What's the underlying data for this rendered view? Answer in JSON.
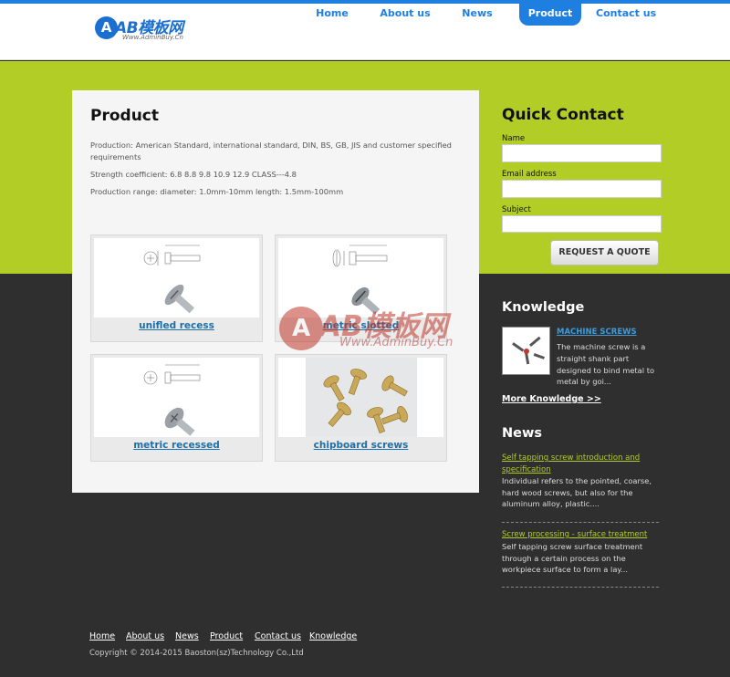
{
  "brand": {
    "logo_letter": "A",
    "logo_text": "AB模板网",
    "logo_sub": "Www.AdminBuy.Cn"
  },
  "nav": {
    "items": [
      {
        "label": "Home"
      },
      {
        "label": "About us"
      },
      {
        "label": "News"
      },
      {
        "label": "Product",
        "active": true
      },
      {
        "label": "Contact us"
      }
    ]
  },
  "product": {
    "title": "Product",
    "paragraphs": [
      "Production: American Standard, international standard, DIN, BS, GB, JIS and customer specified requirements",
      "Strength coefficient: 6.8 8.8 9.8 10.9 12.9 CLASS---4.8",
      "Production range: diameter: 1.0mm-10mm length: 1.5mm-100mm"
    ],
    "items": [
      {
        "label": "unifled recess"
      },
      {
        "label": "metric slotted"
      },
      {
        "label": "metric recessed"
      },
      {
        "label": "chipboard screws"
      }
    ]
  },
  "quick_contact": {
    "title": "Quick Contact",
    "name_label": "Name",
    "email_label": "Email address",
    "subject_label": "Subject",
    "button_label": "REQUEST A QUOTE"
  },
  "knowledge": {
    "title": "Knowledge",
    "item_title": "MACHINE SCREWS",
    "item_text": "The machine screw is a straight shank part designed to bind metal to metal by goi...",
    "more_label": "More Knowledge >>"
  },
  "news": {
    "title": "News",
    "items": [
      {
        "title": "Self tapping screw introduction and specification",
        "text": "Individual refers to the pointed, coarse, hard wood screws, but also for the aluminum alloy, plastic...."
      },
      {
        "title": "Screw processing - surface treatment",
        "text": "Self tapping screw surface treatment through a certain process on the workpiece surface to form a lay..."
      }
    ]
  },
  "footer": {
    "links": [
      "Home",
      "About us",
      "News",
      "Product",
      "Contact us",
      "Knowledge"
    ],
    "copyright": "Copyright © 2014-2015 Baoston(sz)Technology Co.,Ltd"
  },
  "watermark": {
    "letter": "A",
    "text": "AB模板网",
    "sub": "Www.AdminBuy.Cn"
  },
  "colors": {
    "accent_blue": "#1e7fe0",
    "accent_green": "#b2ce26",
    "dark_bg": "#2f2f2f",
    "link_blue": "#1e6fa8"
  },
  "icons": [
    "ab-logo-icon",
    "watermark-logo-icon"
  ]
}
